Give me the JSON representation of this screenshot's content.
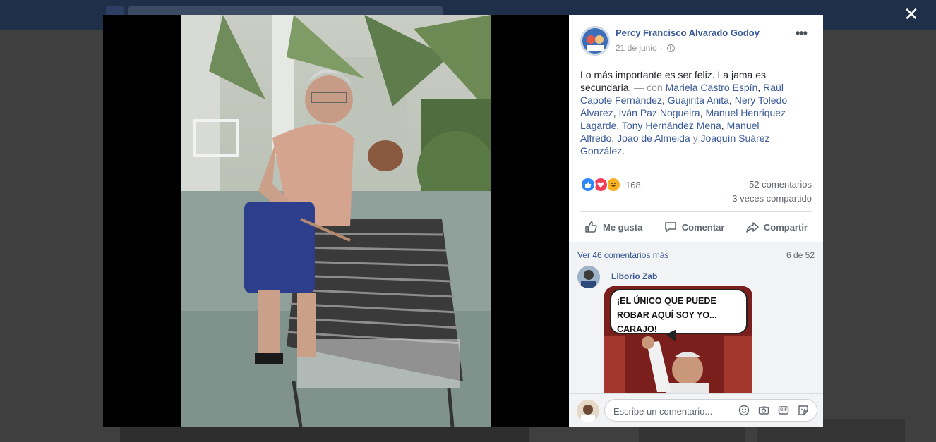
{
  "post": {
    "author": "Percy Francisco Alvarado Godoy",
    "date": "21 de junio",
    "date_sep": "·",
    "more_label": "•••",
    "text_main": "Lo más importante es ser feliz. La jama es secundaria.",
    "with_label": "— con",
    "tagged": [
      "Mariela Castro Espín",
      "Raúl Capote Fernández",
      "Guajirita Anita",
      "Nery Toledo Álvarez",
      "Iván Paz Nogueira",
      "Manuel Henriquez Lagarde",
      "Tony Hernández Mena",
      "Manuel Alfredo",
      "Joao de Almeida",
      "Joaquín Suárez González"
    ],
    "and_word": "y",
    "end_punct": "."
  },
  "stats": {
    "reactions_count": "168",
    "comments": "52 comentarios",
    "shares": "3 veces compartido",
    "reaction_types": [
      "like",
      "love",
      "haha"
    ]
  },
  "actions": {
    "like": "Me gusta",
    "comment": "Comentar",
    "share": "Compartir"
  },
  "comments": {
    "see_more": "Ver 46 comentarios más",
    "pager": "6 de 52",
    "first_author": "Liborio Zab",
    "meme_text": "¡EL ÚNICO QUE PUEDE ROBAR AQUÍ SOY YO... CARAJO!"
  },
  "composer": {
    "placeholder": "Escribe un comentario...",
    "icons": [
      "emoji-icon",
      "camera-icon",
      "gif-icon",
      "sticker-icon"
    ],
    "gif_label": "GIF"
  },
  "lightbox": {
    "close_label": "✕"
  },
  "colors": {
    "link": "#385898",
    "muted": "#90949c",
    "like": "#2d88ff",
    "love": "#f33e58",
    "haha": "#f7b125"
  }
}
